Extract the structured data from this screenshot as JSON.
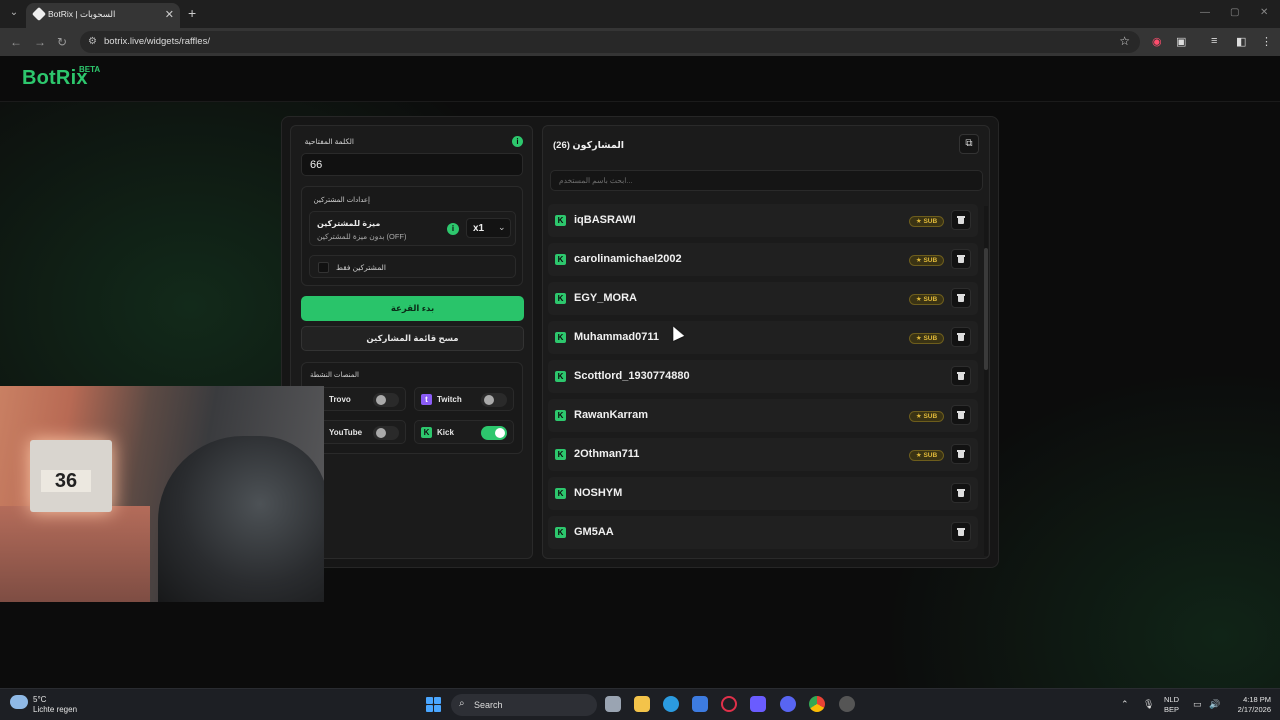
{
  "browser": {
    "tab_title": "BotRix | السحوبات",
    "url": "botrix.live/widgets/raffles/",
    "new_tab": "+",
    "close_tab": "✕"
  },
  "header": {
    "logo": "BotRix",
    "badge": "BETA"
  },
  "left": {
    "keyword_label": "الكلمة المفتاحية",
    "keyword_value": "66",
    "subscriber_settings_label": "إعدادات المشتركين",
    "advantage_title": "ميزة للمشتركين",
    "advantage_subtitle": "بدون ميزة للمشتركين (OFF)",
    "multiplier": "x1",
    "subs_only_label": "المشتركين فقط",
    "start_button": "بدء القرعة",
    "clear_button": "مسح قائمة المشاركين",
    "platforms_label": "المنصات النشطة",
    "platforms": [
      {
        "name": "Trovo",
        "enabled": false
      },
      {
        "name": "Twitch",
        "enabled": false
      },
      {
        "name": "YouTube",
        "enabled": false
      },
      {
        "name": "Kick",
        "enabled": true
      }
    ]
  },
  "right": {
    "title": "المشاركون (26)",
    "search_placeholder": "ابحث باسم المستخدم...",
    "sub_badge": "★ SUB",
    "participants": [
      {
        "name": "iqBASRAWI",
        "sub": true
      },
      {
        "name": "carolinamichael2002",
        "sub": true
      },
      {
        "name": "EGY_MORA",
        "sub": true
      },
      {
        "name": "Muhammad0711",
        "sub": true
      },
      {
        "name": "Scottlord_1930774880",
        "sub": false
      },
      {
        "name": "RawanKarram",
        "sub": true
      },
      {
        "name": "2Othman711",
        "sub": true
      },
      {
        "name": "NOSHYM",
        "sub": false
      },
      {
        "name": "GM5AA",
        "sub": false
      }
    ]
  },
  "webcam": {
    "box_number": "36"
  },
  "taskbar": {
    "weather_temp": "5°C",
    "weather_desc": "Lichte regen",
    "search_label": "Search",
    "lang_1": "NLD",
    "lang_2": "BEP",
    "time": "4:18 PM",
    "date": "2/17/2026"
  },
  "colors": {
    "accent": "#2dc76d",
    "sub_badge": "#e0b93a"
  }
}
